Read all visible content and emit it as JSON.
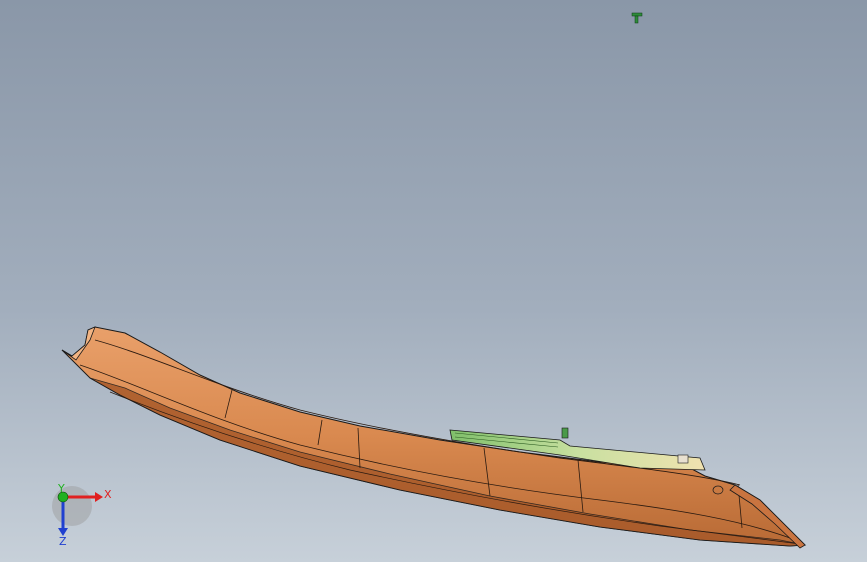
{
  "viewport": {
    "background_top": "#8a97a8",
    "background_bottom": "#c7d0d9"
  },
  "model": {
    "icon": "boat-hull-3d-model",
    "hull_color": "#d9894f",
    "deck_strip_color": "#e8d5a0",
    "edge_color": "#1a1a1a"
  },
  "marker": {
    "icon": "green-pin-marker-icon",
    "color": "#2e8b3a"
  },
  "triad": {
    "icon": "coordinate-triad-icon",
    "x_label": "X",
    "y_label": "Y",
    "z_label": "Z",
    "x_color": "#e02020",
    "y_color": "#20b020",
    "z_color": "#2040d0"
  }
}
